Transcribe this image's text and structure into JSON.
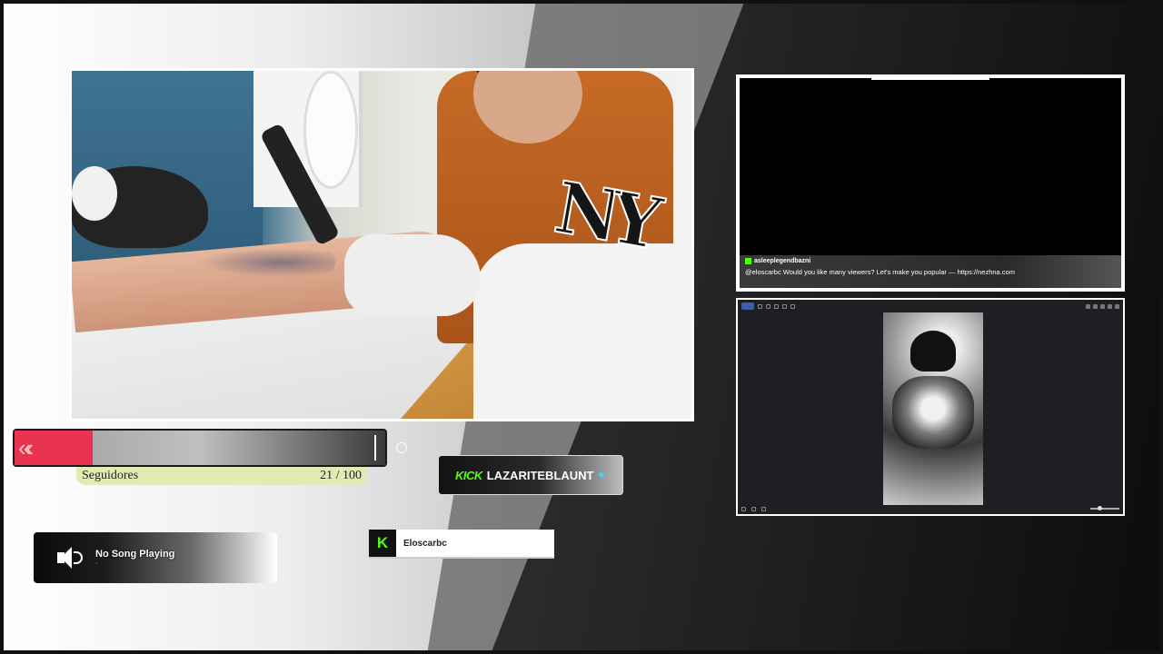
{
  "chat": {
    "messages": [
      {
        "user": "asleeplegendbazni",
        "text": ""
      },
      {
        "user": "",
        "text": "@eloscarbc Would you like many viewers? Let's make you popular — https://nezhna.com"
      }
    ]
  },
  "follower_goal": {
    "label": "Seguidores",
    "count": "21 / 100",
    "progress_fraction": 0.21,
    "fill_color": "#e8344e"
  },
  "channel_badge": {
    "platform": "KICK",
    "name": "LAZARITEBLAUNT",
    "heart": "♥",
    "accent": "#53fc18"
  },
  "now_playing": {
    "title": "No Song Playing",
    "subtitle": "-"
  },
  "latest_follower": {
    "platform_letter": "K",
    "name": "Eloscarbc"
  },
  "icons": [
    "speaker-icon",
    "heart-icon",
    "kick-logo-icon"
  ]
}
